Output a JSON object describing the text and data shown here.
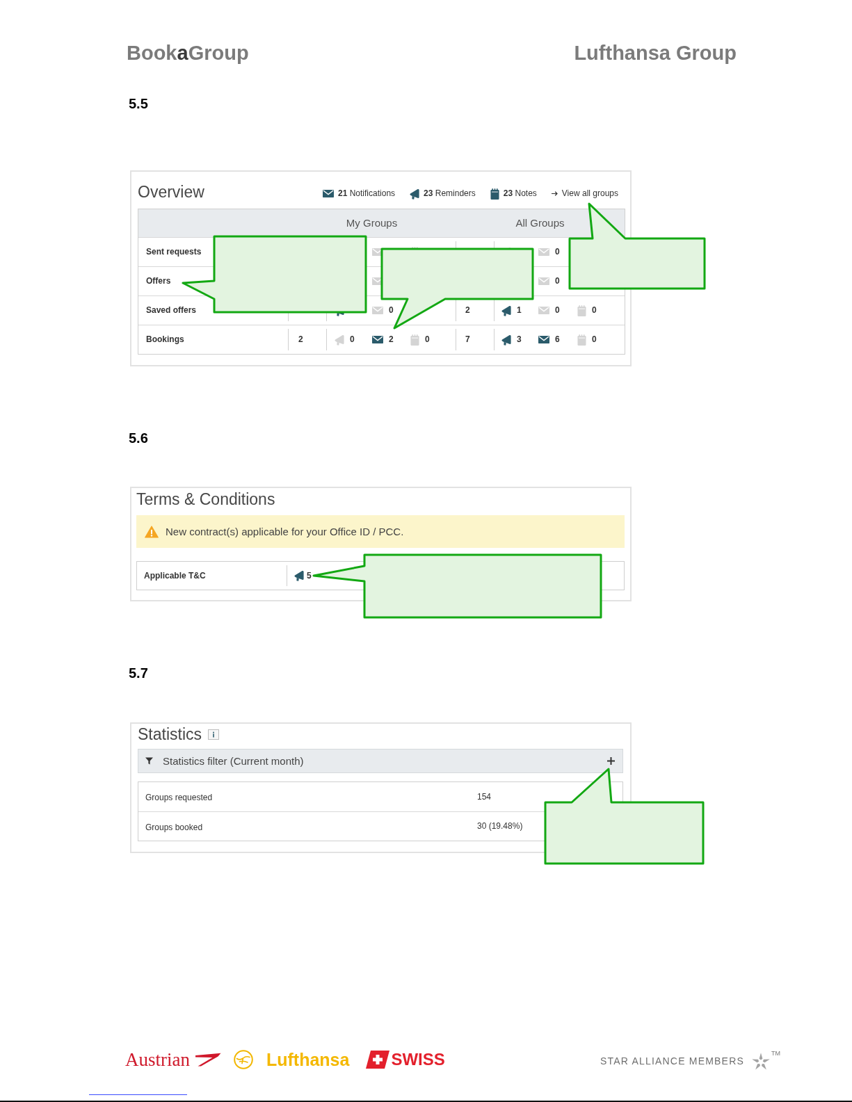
{
  "header": {
    "product_logo": "Book**a**Group",
    "company_logo": "Lufthansa Group"
  },
  "sections": [
    {
      "number": "5.5",
      "panel": {
        "kind": "overview",
        "title": "Overview",
        "summary": [
          {
            "kind": "notifications",
            "text": "**21** Notifications"
          },
          {
            "kind": "reminders",
            "text": "**23** Reminders"
          },
          {
            "kind": "notes",
            "text": "**23** Notes"
          }
        ],
        "link": "View all groups",
        "groups": [
          "My Groups",
          "All Groups"
        ],
        "rows": [
          {
            "label": "Sent requests",
            "cells": [
              null,
              null,
              {
                "kind": "notifications",
                "active": false
              },
              {
                "kind": "notes",
                "active": false
              },
              null,
              {
                "kind": "reminders",
                "active": false
              },
              {
                "kind": "notifications",
                "active": false,
                "value": "0"
              },
              null
            ]
          },
          {
            "label": "Offers",
            "cells": [
              null,
              null,
              {
                "kind": "notifications",
                "active": false
              },
              null,
              null,
              null,
              {
                "kind": "notifications",
                "active": false,
                "value": "0"
              },
              null
            ]
          },
          {
            "label": "Saved offers",
            "cells": [
              null,
              {
                "kind": "reminders",
                "active": true
              },
              {
                "kind": "notifications",
                "active": false,
                "value": "0"
              },
              null,
              {
                "kind": "count",
                "value": "2"
              },
              {
                "kind": "reminders",
                "active": true,
                "value": "1"
              },
              {
                "kind": "notifications",
                "active": false,
                "value": "0"
              },
              {
                "kind": "notes",
                "active": false,
                "value": "0"
              }
            ]
          },
          {
            "label": "Bookings",
            "cells": [
              {
                "kind": "count",
                "value": "2"
              },
              {
                "kind": "reminders",
                "active": false,
                "value": "0"
              },
              {
                "kind": "notifications",
                "active": true,
                "value": "2"
              },
              {
                "kind": "notes",
                "active": false,
                "value": "0"
              },
              {
                "kind": "count",
                "value": "7"
              },
              {
                "kind": "reminders",
                "active": true,
                "value": "3"
              },
              {
                "kind": "notifications",
                "active": true,
                "value": "6"
              },
              {
                "kind": "notes",
                "active": false,
                "value": "0"
              }
            ]
          }
        ]
      }
    },
    {
      "number": "5.6",
      "panel": {
        "kind": "terms",
        "title": "Terms & Conditions",
        "alert": "New contract(s) applicable for your Office ID / PCC.",
        "rows": [
          {
            "label": "Applicable T&C",
            "kind": "reminders",
            "active": true,
            "value": "5"
          }
        ]
      }
    },
    {
      "number": "5.7",
      "panel": {
        "kind": "statistics",
        "title": "Statistics",
        "filter": {
          "label": "Statistics filter (Current month)",
          "expanded": false
        },
        "rows": [
          {
            "label": "Groups requested",
            "value": "154"
          },
          {
            "label": "Groups booked",
            "value": "30 (19.48%)"
          }
        ]
      }
    }
  ],
  "footer": {
    "logos": [
      {
        "kind": "austrian",
        "text": "Austrian"
      },
      {
        "kind": "lufthansa",
        "text": "Lufthansa"
      },
      {
        "kind": "swiss",
        "text": "SWISS"
      }
    ],
    "alliance": {
      "text": "STAR ALLIANCE MEMBERS",
      "mark": "TM"
    }
  }
}
